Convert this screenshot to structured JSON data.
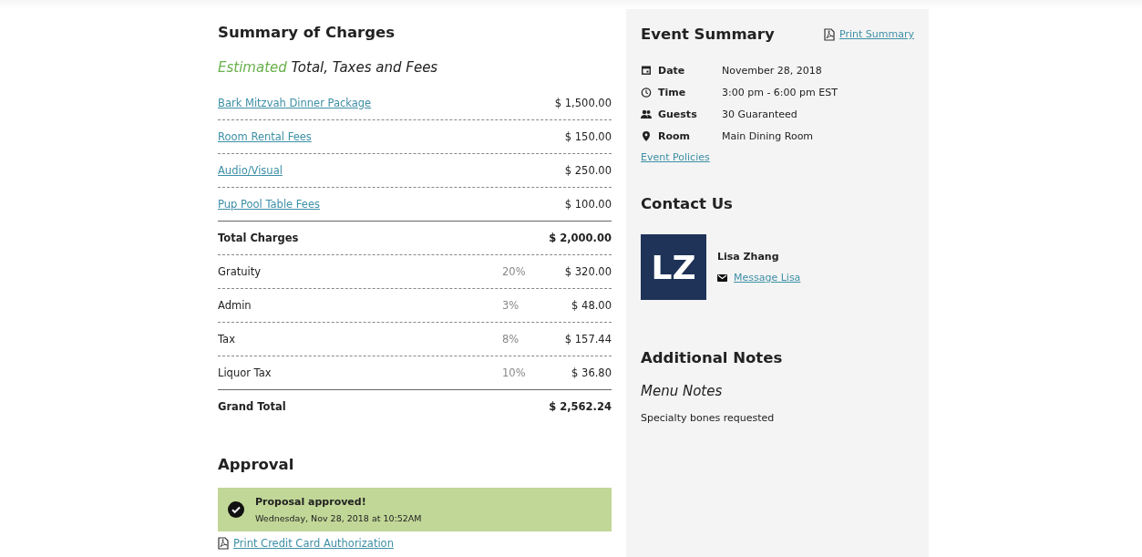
{
  "charges": {
    "title": "Summary of Charges",
    "subtitle": "*Estimated* Total, Taxes and Fees",
    "rows": [
      {
        "kind": "link",
        "label": "Bark Mitzvah Dinner Package",
        "amount": "$ 1,500.00"
      },
      {
        "kind": "link",
        "label": "Room Rental Fees",
        "amount": "$ 150.00"
      },
      {
        "kind": "link",
        "label": "Audio/Visual",
        "amount": "$ 250.00"
      },
      {
        "kind": "link",
        "label": "Pup Pool Table Fees",
        "amount": "$ 100.00"
      },
      {
        "kind": "total",
        "label": "Total Charges",
        "amount": "$ 2,000.00"
      },
      {
        "kind": "fee",
        "label": "Gratuity",
        "rate": "20%",
        "amount": "$ 320.00"
      },
      {
        "kind": "fee",
        "label": "Admin",
        "rate": "3%",
        "amount": "$ 48.00"
      },
      {
        "kind": "fee",
        "label": "Tax",
        "rate": "8%",
        "amount": "$ 157.44"
      },
      {
        "kind": "fee",
        "label": "Liquor Tax",
        "rate": "10%",
        "amount": "$ 36.80"
      },
      {
        "kind": "grand",
        "label": "Grand Total",
        "amount": "$ 2,562.24"
      }
    ]
  },
  "approval": {
    "title": "Approval",
    "approved": true,
    "message": "Proposal approved!",
    "timestamp": "Wednesday, Nov 28, 2018 at 10:52AM",
    "print_link": "Print Credit Card Authorization"
  },
  "event_summary": {
    "title": "Event Summary",
    "print_link": "Print Summary",
    "details": [
      {
        "kind": "date",
        "label": "Date",
        "value": "November 28, 2018"
      },
      {
        "kind": "time",
        "label": "Time",
        "value": "3:00 pm - 6:00 pm EST"
      },
      {
        "kind": "guests",
        "label": "Guests",
        "value": "30 Guaranteed"
      },
      {
        "kind": "room",
        "label": "Room",
        "value": "Main Dining Room"
      }
    ],
    "policies_link": "Event Policies"
  },
  "contact": {
    "title": "Contact Us",
    "initials": "LZ",
    "name": "Lisa Zhang",
    "message_link": "Message Lisa"
  },
  "notes": {
    "title": "Additional Notes",
    "subtitle": "Menu Notes",
    "text": "Specialty bones requested"
  }
}
